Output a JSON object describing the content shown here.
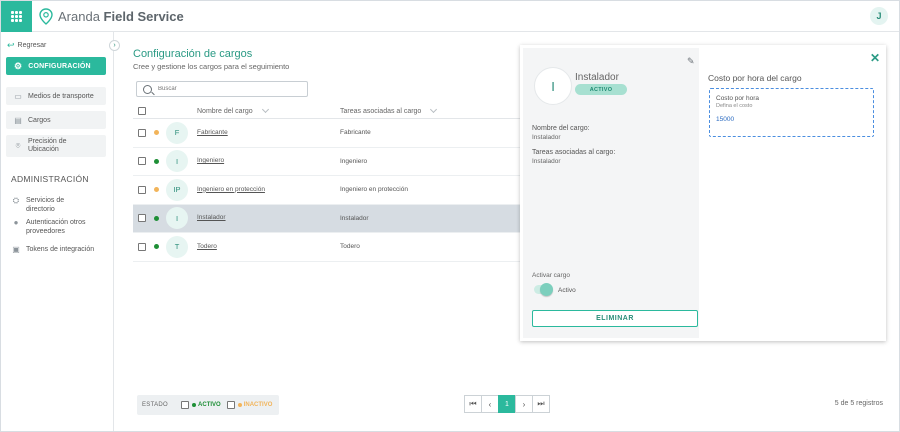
{
  "app": {
    "brand_light": "Aranda",
    "brand_bold": "Field Service",
    "user_initial": "J",
    "accent": "#2bb99d"
  },
  "sidebar": {
    "back_label": "Regresar",
    "config_label": "CONFIGURACIÓN",
    "items": [
      {
        "label": "Medios de transporte",
        "icon": "car-icon"
      },
      {
        "label": "Cargos",
        "icon": "id-card-icon"
      },
      {
        "label": "Precisión de Ubicación",
        "icon": "location-icon"
      }
    ],
    "admin_section": "ADMINISTRACIÓN",
    "admin_items": [
      {
        "label": "Servicios de directorio",
        "icon": "directory-icon"
      },
      {
        "label": "Autenticación otros proveedores",
        "icon": "lock-icon"
      },
      {
        "label": "Tokens de integración",
        "icon": "token-icon"
      }
    ]
  },
  "main": {
    "title": "Configuración de cargos",
    "subtitle": "Cree y gestione los cargos para el seguimiento",
    "search_placeholder": "Buscar",
    "columns": {
      "name": "Nombre del cargo",
      "tasks": "Tareas asociadas al cargo"
    },
    "rows": [
      {
        "initials": "F",
        "name": "Fabricante",
        "tasks": "Fabricante",
        "status": "inactive"
      },
      {
        "initials": "I",
        "name": "Ingeniero",
        "tasks": "Ingeniero",
        "status": "active"
      },
      {
        "initials": "IP",
        "name": "Ingeniero en protección",
        "tasks": "Ingeniero en protección",
        "status": "inactive"
      },
      {
        "initials": "I",
        "name": "Instalador",
        "tasks": "Instalador",
        "status": "active",
        "selected": true
      },
      {
        "initials": "T",
        "name": "Todero",
        "tasks": "Todero",
        "status": "active"
      }
    ],
    "status_colors": {
      "active": "#1e8f36",
      "inactive": "#f2b45a"
    }
  },
  "footer": {
    "filter_label": "ESTADO",
    "active_label": "ACTIVO",
    "inactive_label": "INACTIVO",
    "current_page": "1",
    "records": "5 de 5 registros"
  },
  "panel": {
    "initial": "I",
    "name": "Instalador",
    "badge": "ACTIVO",
    "name_label": "Nombre del cargo:",
    "name_value": "Instalador",
    "tasks_label": "Tareas asociadas al cargo:",
    "tasks_value": "Instalador",
    "activate_label": "Activar cargo",
    "toggle_label": "Activo",
    "delete_label": "ELIMINAR",
    "cost_title": "Costo por hora del cargo",
    "cost_label": "Costo por hora",
    "cost_sub": "Defina el costo",
    "cost_value": "15000"
  }
}
